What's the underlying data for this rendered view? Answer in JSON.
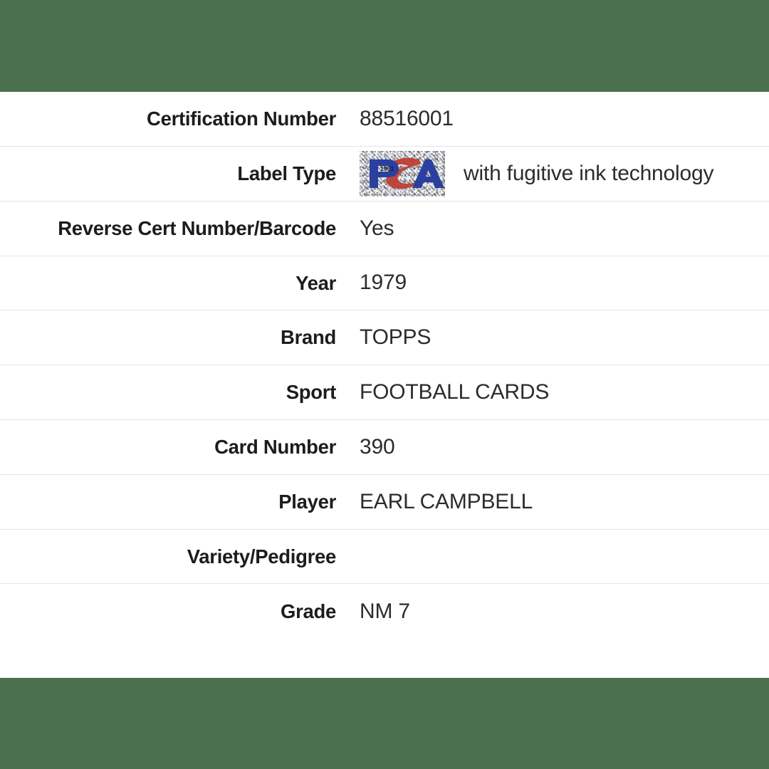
{
  "theme": {
    "band_color": "#4a7050",
    "background": "#ffffff",
    "label_color": "#1c1c1e",
    "value_color": "#2c2c2e",
    "row_divider_color": "#e2e4e6",
    "psa_blue": "#2b3f9e",
    "psa_red": "#c0392f",
    "psa_label_bg": "#b9bec5"
  },
  "cert_table": {
    "rows": [
      {
        "label": "Certification Number",
        "value": "88516001",
        "type": "text"
      },
      {
        "label": "Label Type",
        "value": "with fugitive ink technology",
        "type": "logo_text",
        "logo": "psa-logo"
      },
      {
        "label": "Reverse Cert Number/Barcode",
        "value": "Yes",
        "type": "text"
      },
      {
        "label": "Year",
        "value": "1979",
        "type": "text"
      },
      {
        "label": "Brand",
        "value": "TOPPS",
        "type": "text"
      },
      {
        "label": "Sport",
        "value": "FOOTBALL CARDS",
        "type": "text"
      },
      {
        "label": "Card Number",
        "value": "390",
        "type": "text"
      },
      {
        "label": "Player",
        "value": "EARL CAMPBELL",
        "type": "text"
      },
      {
        "label": "Variety/Pedigree",
        "value": "",
        "type": "text"
      },
      {
        "label": "Grade",
        "value": "NM 7",
        "type": "text"
      }
    ]
  },
  "psa_logo": {
    "alt": "PSA",
    "letters": "PSA",
    "small_text": "1991"
  }
}
